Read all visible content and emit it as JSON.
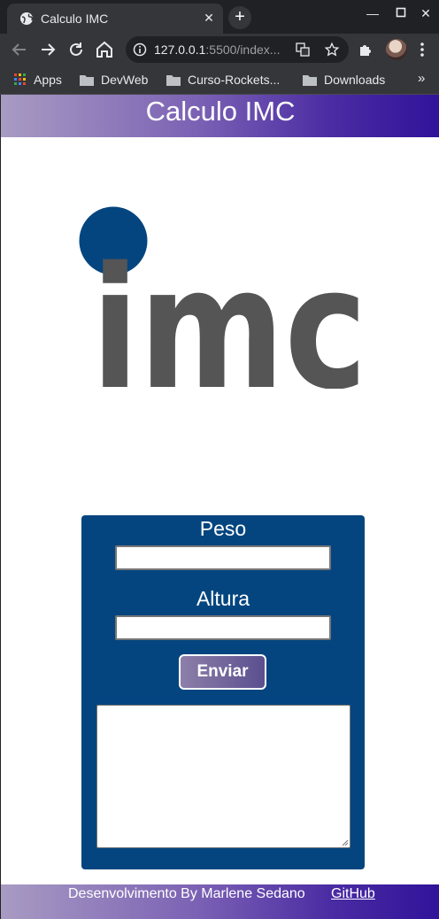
{
  "browser": {
    "tab_title": "Calculo IMC",
    "url_host": "127.0.0.1",
    "url_rest": ":5500/index...",
    "bookmarks": [
      "Apps",
      "DevWeb",
      "Curso-Rockets...",
      "Downloads"
    ],
    "bookmarks_more": "»"
  },
  "header": {
    "title": "Calculo IMC"
  },
  "logo": {
    "text": "imc",
    "dot_color": "#04457f",
    "text_color": "#555555"
  },
  "form": {
    "peso_label": "Peso",
    "peso_value": "",
    "altura_label": "Altura",
    "altura_value": "",
    "submit_label": "Enviar",
    "result_value": ""
  },
  "footer": {
    "credit": "Desenvolvimento By Marlene Sedano",
    "link_label": "GitHub"
  },
  "colors": {
    "card": "#04457f",
    "gradient_start": "#a89bc3",
    "gradient_end": "#2f139a"
  }
}
